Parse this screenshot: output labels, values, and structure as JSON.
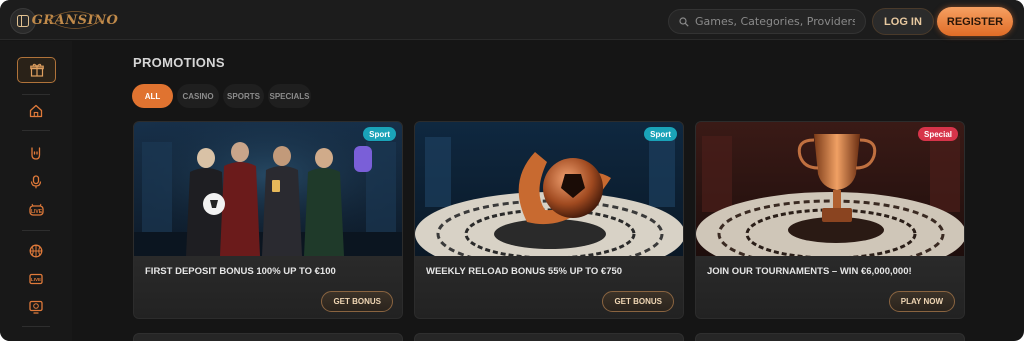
{
  "header": {
    "logo_text": "GRANSINO",
    "search_placeholder": "Games, Categories, Providers",
    "login_label": "LOG IN",
    "register_label": "REGISTER"
  },
  "page": {
    "title": "PROMOTIONS"
  },
  "tabs": [
    {
      "label": "ALL",
      "active": true
    },
    {
      "label": "CASINO",
      "active": false
    },
    {
      "label": "SPORTS",
      "active": false
    },
    {
      "label": "SPECIALS",
      "active": false
    }
  ],
  "sidebar": {
    "icons": [
      "gift-icon",
      "home-icon",
      "rock-hand-icon",
      "microphone-icon",
      "live-casino-icon",
      "basketball-icon",
      "live-tv-icon",
      "virtual-sports-icon"
    ]
  },
  "promotions": [
    {
      "badge": "Sport",
      "badge_color": "#1aa3b8",
      "title": "FIRST DEPOSIT BONUS 100% UP TO €100",
      "button": "GET BONUS"
    },
    {
      "badge": "Sport",
      "badge_color": "#1aa3b8",
      "title": "WEEKLY RELOAD BONUS 55% UP TO €750",
      "button": "GET BONUS"
    },
    {
      "badge": "Special",
      "badge_color": "#d7344a",
      "title": "JOIN OUR TOURNAMENTS – WIN €6,000,000!",
      "button": "PLAY NOW"
    }
  ],
  "colors": {
    "accent": "#e07330",
    "background": "#151515",
    "sport_badge": "#1aa3b8",
    "special_badge": "#d7344a"
  }
}
